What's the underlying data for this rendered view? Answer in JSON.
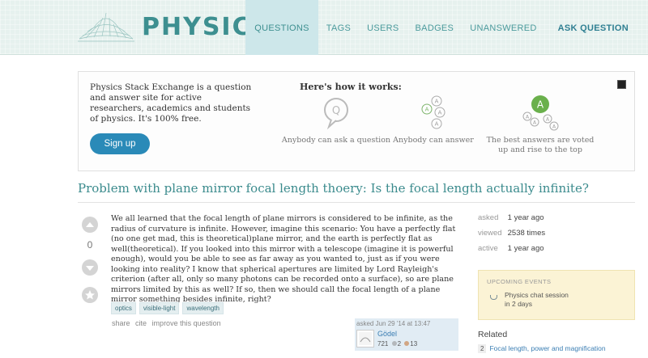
{
  "site": {
    "logo_text": "PHYSICS"
  },
  "nav": {
    "items": [
      {
        "label": "QUESTIONS",
        "active": true
      },
      {
        "label": "TAGS",
        "active": false
      },
      {
        "label": "USERS",
        "active": false
      },
      {
        "label": "BADGES",
        "active": false
      },
      {
        "label": "UNANSWERED",
        "active": false
      }
    ],
    "ask_label": "ASK QUESTION"
  },
  "welcome": {
    "text": "Physics Stack Exchange is a question and answer site for active researchers, academics and students of physics. It's 100% free.",
    "signup_label": "Sign up",
    "how_title": "Here's how it works:",
    "steps": [
      {
        "label": "Anybody can ask a question",
        "icon": "question-bubble-icon"
      },
      {
        "label": "Anybody can answer",
        "icon": "answer-bubbles-icon"
      },
      {
        "label": "The best answers are voted up and rise to the top",
        "icon": "best-answer-icon"
      }
    ]
  },
  "question": {
    "title": "Problem with plane mirror focal length thoery: Is the focal length actually infinite?",
    "votes": "0",
    "body": "We all learned that the focal length of plane mirrors is considered to be infinite, as the radius of curvature is infinite. However, imagine this scenario: You have a perfectly flat (no one get mad, this is theoretical)plane mirror, and the earth is perfectly flat as well(theoretical). If you looked into this mirror with a telescope (imagine it is powerful enough), would you be able to see as far away as you wanted to, just as if you were looking into reality? I know that spherical apertures are limited by Lord Rayleigh's criterion (after all, only so many photons can be recorded onto a surface), so are plane mirrors limited by this as well? If so, then we should call the focal length of a plane mirror something besides infinite, right?",
    "tags": [
      "optics",
      "visible-light",
      "wavelength"
    ],
    "menu": [
      "share",
      "cite",
      "improve this question"
    ],
    "owner": {
      "asked": "asked Jun 29 '14 at 13:47",
      "name": "Gödel",
      "reputation": "721",
      "silver": "2",
      "bronze": "13"
    }
  },
  "stats": [
    {
      "label": "asked",
      "value": "1 year ago"
    },
    {
      "label": "viewed",
      "value": "2538 times"
    },
    {
      "label": "active",
      "value": "1 year ago"
    }
  ],
  "events": {
    "title": "UPCOMING EVENTS",
    "name": "Physics chat session",
    "when": "in 2 days"
  },
  "related": {
    "title": "Related",
    "items": [
      {
        "count": "2",
        "title": "Focal length, power and magnification"
      }
    ]
  },
  "colors": {
    "brand": "#3d8f90",
    "link": "#3b7eb3",
    "signup": "#2a8ab8",
    "best_answer": "#6ab04c"
  }
}
